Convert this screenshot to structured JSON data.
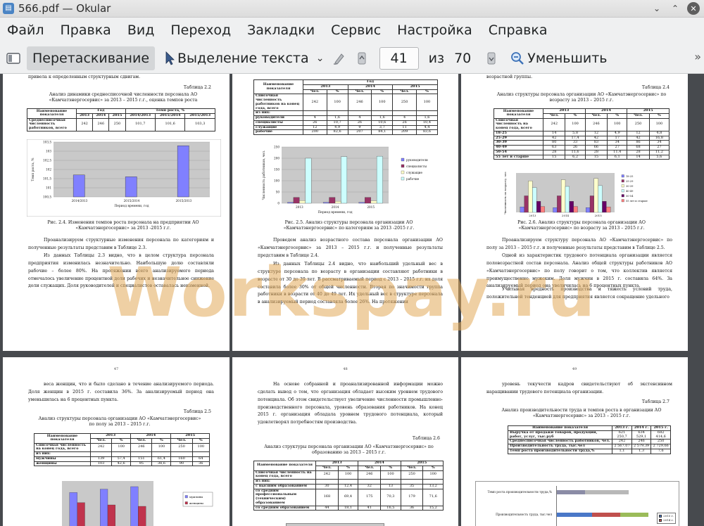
{
  "window": {
    "title": "566.pdf  — Okular"
  },
  "menu": [
    "Файл",
    "Правка",
    "Вид",
    "Переход",
    "Закладки",
    "Сервис",
    "Настройка",
    "Справка"
  ],
  "toolbar": {
    "drag_label": "Перетаскивание",
    "select_label": "Выделение текста",
    "page_current": "41",
    "page_of": "из",
    "page_total": "70",
    "zoom_out_label": "Уменьшить"
  },
  "watermark": "Workspay.ru",
  "pages": {
    "p1": {
      "top_text": "привела к определенным структурным сдвигам.",
      "table_no": "Таблица 2.2",
      "table_caption": "Анализ динамики среднесписочной численности персонала АО «Камчатэнергосервис» за 2013 – 2015 г.г., оценка темпов роста",
      "table": {
        "h1": [
          "Наименование показателя",
          "Год",
          "Темп роста, %"
        ],
        "h2": [
          "2013",
          "2014",
          "2015",
          "2014/2013",
          "2015/2014",
          "2015/2013"
        ],
        "row": [
          "Среднесписочная численность работников, всего",
          "242",
          "246",
          "250",
          "101,7",
          "101,6",
          "103,3"
        ]
      },
      "caption": "Рис. 2.4. Изменения темпов роста персонала на предприятии АО «Камчатэнергосервис» за 2013 -2015 г.г.",
      "para1": "Проанализируем структурные изменения персонала по категориям и полученные результаты представим в Таблице 2.3.",
      "para2": "Из данных Таблицы 2.3 видно, что в целом структура персонала предприятия изменилась незначительно. Наибольшую долю составляли рабочие – более 80%. На протяжении всего анализируемого периода отмечалось увеличение процентной доли рабочих и незначительное снижение доли служащих. Доля руководителей и специалистов оставалась неизменной."
    },
    "p2": {
      "table": {
        "h1": [
          "Наименование показателя",
          "Год"
        ],
        "years": [
          "2013",
          "2014",
          "2015"
        ],
        "sub": [
          "Чел.",
          "%",
          "Чел.",
          "%",
          "Чел.",
          "%"
        ],
        "rows": [
          [
            "Списочная численность работников на конец года, всего",
            "242",
            "100",
            "246",
            "100",
            "250",
            "100"
          ],
          [
            "из них:",
            "",
            "",
            "",
            "",
            "",
            ""
          ],
          [
            "руководители",
            "4",
            "1,6",
            "4",
            "1,6",
            "4",
            "1,6"
          ],
          [
            "специалисты",
            "26",
            "10,7",
            "26",
            "10,6",
            "26",
            "10,4"
          ],
          [
            "служащие",
            "12",
            "4,9",
            "9",
            "3,7",
            "11",
            "4,4"
          ],
          [
            "рабочие",
            "200",
            "82,6",
            "207",
            "84,1",
            "209",
            "83,6"
          ]
        ]
      },
      "caption": "Рис. 2.5. Анализ структуры персонала организации АО «Камчатэнергосервис» по категориям за 2013 -2015 г.г.",
      "para1": "Проведем анализ возрастного состава персонала организации АО «Камчатэнергосервис» за 2013 – 2015 г.г. и полученные результаты представим в Таблице 2.4.",
      "para2": "Из данных Таблицы 2.4 видно, что наибольший удельный вес в структуре персонала по возрасту в организации составляют работники в возрасте от 30 до 39 лет. В рассматриваемый период с 2013 – 2015 г.г. их доля составила более 30% от общей численности. Вторая по значимости группа работники в возрасти от 40 до 49 лет. Их удельный вес в структуре персонала в анализируемый период составляла более 26%. На протяжении"
    },
    "p3": {
      "top_text": "возрастной группы.",
      "table_no": "Таблица 2.4",
      "table_caption": "Анализ структуры персонала организации АО «Камчатэнергосервис» по возрасту за 2013 – 2015 г.г.",
      "table": {
        "rows": [
          [
            "Списочная численность на конец года, всего",
            "242",
            "100",
            "246",
            "100",
            "250",
            "100"
          ],
          [
            "18-25",
            "14",
            "5,8",
            "12",
            "4,9",
            "12",
            "4,8"
          ],
          [
            "25-29",
            "42",
            "17,4",
            "42",
            "17",
            "42",
            "16,8"
          ],
          [
            "30-39",
            "80",
            "33",
            "83",
            "34",
            "86",
            "34"
          ],
          [
            "40-49",
            "63",
            "26",
            "66",
            "27",
            "68",
            "27"
          ],
          [
            "50-54",
            "28",
            "11,6",
            "28",
            "11,4",
            "28",
            "11,2"
          ],
          [
            "55 лет и старше",
            "15",
            "6,2",
            "15",
            "6,1",
            "14",
            "5,6"
          ]
        ]
      },
      "caption": "Рис. 2.6. Анализ структуры персонала организации АО «Камчатэнергосервис» по возрасту за 2013 – 2015 г.г.",
      "para1": "Проанализируем структуру персонала АО «Камчатэнергосервис» по полу за 2013 – 2015 г.г. и полученные результаты представим в Таблице 2.5.",
      "para2": "Одной из характеристик трудового потенциала организации является половозрастной состав персонала. Анализ общей структуры работников АО «Камчатэнергосервис» по полу говорит о том, что коллектив является преимущественно мужским. Доля мужчин в 2015 г. составила 64%. За анализируемый период она увеличилась на 6 процентных пункта.",
      "para3": "Учитывая вредность производства и тяжесть условий труда, положительной тенденцией для предприятия является сокращение удельного"
    },
    "p4": {
      "num": "47",
      "para1": "веса женщин, что и было сделано в течение анализируемого периода. Доля женщин в 2015 г. составила 36%. За анализируемый период она уменьшилась на 6 процентных пункта.",
      "table_no": "Таблица 2.5",
      "table_caption": "Анализ структуры персонала организации АО «Камчатэнергосервис» по полу за 2013 – 2015 г.г.",
      "rows": [
        [
          "Списочная численность на конец года, всего",
          "242",
          "100",
          "246",
          "100",
          "250",
          "100"
        ],
        [
          "из них:",
          "",
          "",
          "",
          "",
          "",
          ""
        ],
        [
          "мужчины",
          "139",
          "57,4",
          "151",
          "61,4",
          "160",
          "64"
        ],
        [
          "женщины",
          "103",
          "42,6",
          "95",
          "38,6",
          "90",
          "36"
        ]
      ],
      "legend": [
        "мужчины",
        "женщины"
      ]
    },
    "p5": {
      "num": "48",
      "para1": "На основе собранной и проанализированной информации можно сделать вывод о том, что организация обладает высоким уровнем трудового потенциала. Об этом свидетельствует увеличение численности промышленно-производственного персонала, уровень образования работников. На конец 2015 г. организация обладала уровнем трудового потенциала, который удовлетворял потребностям производства.",
      "table_no": "Таблица 2.6",
      "table_caption": "Анализ структуры персонала организации АО «Камчатэнергосервис» по образованию за 2013 – 2015 г.г.",
      "rows": [
        [
          "Списочная численность на конец года, всего",
          "242",
          "100",
          "246",
          "100",
          "250",
          "100"
        ],
        [
          "из них:",
          "",
          "",
          "",
          "",
          "",
          ""
        ],
        [
          "с высшим образованием",
          "30",
          "12,4",
          "32",
          "13",
          "35",
          "13,2"
        ],
        [
          "со средним профессиональным (техническим) образованием",
          "168",
          "69,4",
          "175",
          "70,3",
          "179",
          "71,6"
        ],
        [
          "со средним образованием",
          "44",
          "18,1",
          "41",
          "16,5",
          "36",
          "15,2"
        ]
      ]
    },
    "p6": {
      "num": "49",
      "para1": "уровень текучести кадров свидетельствуют об экстенсивном наращивании трудового потенциала организации.",
      "table_no": "Таблица 2.7",
      "table_caption": "Анализ производительности труда и темпов роста в организации АО «Камчатэнергосервис» за 2013 – 2015 г.г.",
      "head": [
        "Наименование показателя",
        "2013 г.",
        "2014 г.",
        "2015 г."
      ],
      "rows": [
        [
          "Выручка от продажи товаров, продукции, работ, услуг, тыс.руб",
          "621 250,7",
          "634 529,1",
          "682 414,6"
        ],
        [
          "Среднесписочная численность работников, чел.",
          "242",
          "246",
          "250"
        ],
        [
          "Производительность труда, тыс.чел",
          "2 567,07",
          "2 579,39",
          "2 729,66"
        ],
        [
          "Темп роста производительности труда,%",
          "1,1",
          "1,3",
          "7,6"
        ]
      ],
      "chart_labels": [
        "Темп роста производительности труда,%",
        "Производительность труда, тыс.чел"
      ],
      "legend": [
        "2015 г.",
        "2014 г."
      ]
    }
  },
  "chart_data": [
    {
      "type": "bar",
      "categories": [
        "2014/2013",
        "2015/2014",
        "2015/2013"
      ],
      "values": [
        101.7,
        101.6,
        103.3
      ],
      "xlabel": "Период времени, год",
      "ylabel": "Темп роста, %",
      "ylim": [
        100.5,
        103.5
      ],
      "yticks": [
        "103,5",
        "103",
        "102,5",
        "102",
        "101,5",
        "101",
        "100,5"
      ]
    },
    {
      "type": "bar",
      "categories": [
        "2013",
        "2014",
        "2015"
      ],
      "xlabel": "Период времени, год",
      "ylabel": "Численность работников, чел.",
      "ylim": [
        0,
        250
      ],
      "yticks": [
        "250",
        "200",
        "150",
        "100",
        "50",
        "0"
      ],
      "series": [
        {
          "name": "руководители",
          "values": [
            4,
            4,
            4
          ],
          "color": "#8080ff"
        },
        {
          "name": "специалисты",
          "values": [
            26,
            26,
            26
          ],
          "color": "#993366"
        },
        {
          "name": "служащие",
          "values": [
            12,
            9,
            11
          ],
          "color": "#ffffcc"
        },
        {
          "name": "рабочие",
          "values": [
            200,
            207,
            209
          ],
          "color": "#ccffff"
        }
      ]
    },
    {
      "type": "bar",
      "categories": [
        "2013",
        "2014",
        "2015"
      ],
      "ylabel": "Численность по возрасту, чел.",
      "ylim": [
        0,
        100
      ],
      "series": [
        {
          "name": "18-25",
          "values": [
            14,
            12,
            12
          ],
          "color": "#8080ff"
        },
        {
          "name": "25-29",
          "values": [
            42,
            42,
            42
          ],
          "color": "#993366"
        },
        {
          "name": "30-39",
          "values": [
            80,
            83,
            86
          ],
          "color": "#ffffcc"
        },
        {
          "name": "40-49",
          "values": [
            63,
            66,
            68
          ],
          "color": "#ccffff"
        },
        {
          "name": "50-54",
          "values": [
            28,
            28,
            28
          ],
          "color": "#660066"
        },
        {
          "name": "55 лет и старше",
          "values": [
            15,
            15,
            14
          ],
          "color": "#ff8080"
        }
      ],
      "legend": [
        "18-25",
        "25-29",
        "30-39",
        "40-49",
        "50-54",
        "55 лет и старше"
      ]
    },
    {
      "type": "bar",
      "categories": [
        "2013",
        "2014",
        "2015"
      ],
      "ylim": [
        0,
        180
      ],
      "series": [
        {
          "name": "мужчины",
          "values": [
            139,
            151,
            160
          ],
          "color": "#8080ff"
        },
        {
          "name": "женщины",
          "values": [
            103,
            95,
            90
          ],
          "color": "#c0334d"
        }
      ]
    }
  ]
}
